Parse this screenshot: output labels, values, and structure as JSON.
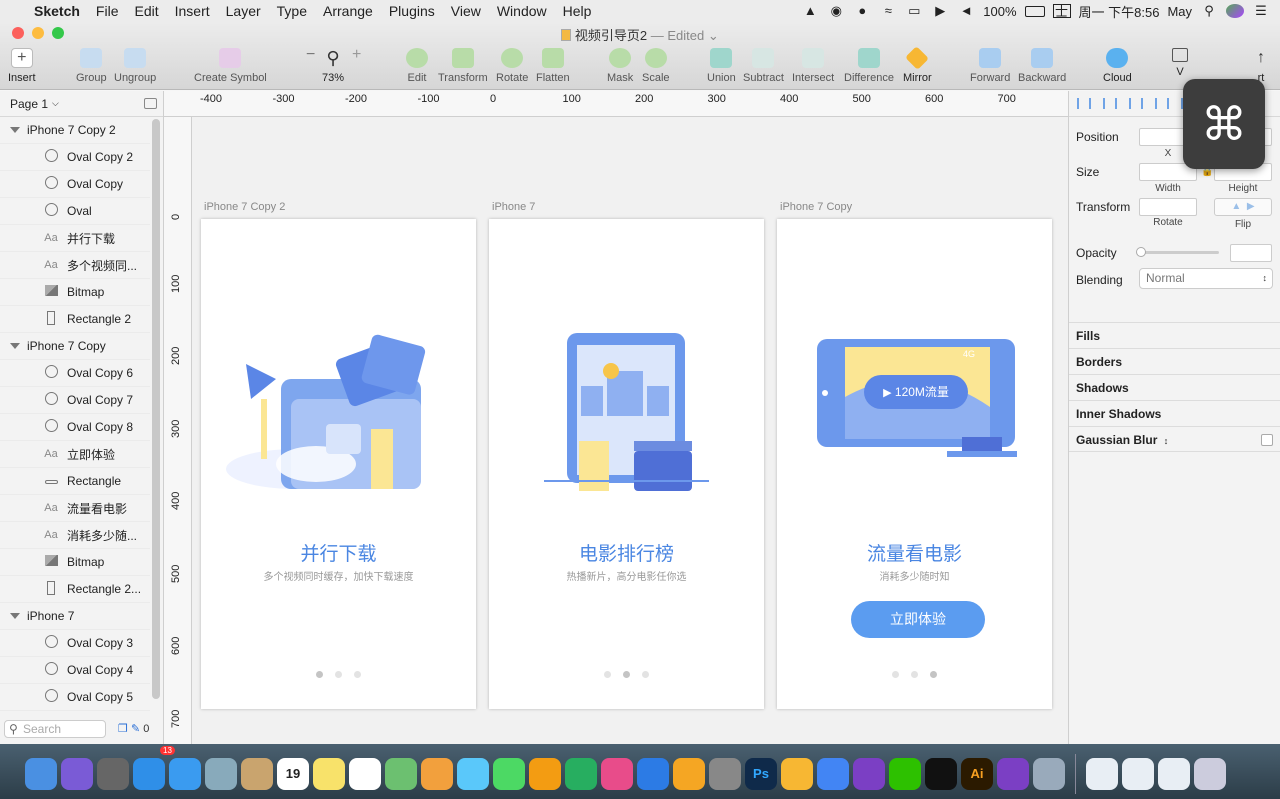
{
  "menubar": {
    "apple": "",
    "app": "Sketch",
    "items": [
      "File",
      "Edit",
      "Insert",
      "Layer",
      "Type",
      "Arrange",
      "Plugins",
      "View",
      "Window",
      "Help"
    ],
    "battery": "100%",
    "clock": "周一 下午8:56",
    "user": "May"
  },
  "window": {
    "title": "视频引导页2",
    "edited": " — Edited ⌄"
  },
  "toolbar": {
    "insert": "Insert",
    "group": "Group",
    "ungroup": "Ungroup",
    "create_symbol": "Create Symbol",
    "zoom_minus": "−",
    "zoom_plus": "+",
    "zoom": "73%",
    "edit": "Edit",
    "transform": "Transform",
    "rotate": "Rotate",
    "flatten": "Flatten",
    "mask": "Mask",
    "scale": "Scale",
    "union": "Union",
    "subtract": "Subtract",
    "intersect": "Intersect",
    "difference": "Difference",
    "mirror": "Mirror",
    "forward": "Forward",
    "backward": "Backward",
    "cloud": "Cloud",
    "view": "V",
    "export": "rt"
  },
  "layers": {
    "page": "Page 1",
    "rows": [
      {
        "kind": "group",
        "label": "iPhone 7 Copy 2"
      },
      {
        "kind": "oval",
        "label": "Oval Copy 2"
      },
      {
        "kind": "oval",
        "label": "Oval Copy"
      },
      {
        "kind": "oval",
        "label": "Oval"
      },
      {
        "kind": "text",
        "label": "并行下载"
      },
      {
        "kind": "text",
        "label": "多个视频同..."
      },
      {
        "kind": "bitmap",
        "label": "Bitmap"
      },
      {
        "kind": "rect",
        "label": "Rectangle 2"
      },
      {
        "kind": "group",
        "label": "iPhone 7 Copy"
      },
      {
        "kind": "oval",
        "label": "Oval Copy 6"
      },
      {
        "kind": "oval",
        "label": "Oval Copy 7"
      },
      {
        "kind": "oval",
        "label": "Oval Copy 8"
      },
      {
        "kind": "text",
        "label": "立即体验"
      },
      {
        "kind": "line",
        "label": "Rectangle"
      },
      {
        "kind": "text",
        "label": "流量看电影"
      },
      {
        "kind": "text",
        "label": "消耗多少随..."
      },
      {
        "kind": "bitmap",
        "label": "Bitmap"
      },
      {
        "kind": "rect",
        "label": "Rectangle 2..."
      },
      {
        "kind": "group",
        "label": "iPhone 7"
      },
      {
        "kind": "oval",
        "label": "Oval Copy 3"
      },
      {
        "kind": "oval",
        "label": "Oval Copy 4"
      },
      {
        "kind": "oval",
        "label": "Oval Copy 5"
      }
    ],
    "search_placeholder": "Search",
    "count": "0"
  },
  "rulers": {
    "h": [
      "-400",
      "-300",
      "-200",
      "-100",
      "0",
      "100",
      "200",
      "300",
      "400",
      "500",
      "600",
      "700"
    ],
    "v": [
      "0",
      "100",
      "200",
      "300",
      "400",
      "500",
      "600",
      "700"
    ]
  },
  "artboards": [
    {
      "label": "iPhone 7 Copy 2",
      "heading": "并行下载",
      "sub": "多个视频同时缓存，加快下载速度",
      "active_dot": 0,
      "cta": ""
    },
    {
      "label": "iPhone 7",
      "heading": "电影排行榜",
      "sub": "热播新片，高分电影任你选",
      "active_dot": 1,
      "cta": ""
    },
    {
      "label": "iPhone 7 Copy",
      "heading": "流量看电影",
      "sub": "消耗多少随时知",
      "active_dot": 2,
      "cta": "立即体验",
      "badge": "120M流量",
      "signal": "4G"
    }
  ],
  "inspector": {
    "position": "Position",
    "x": "X",
    "y": "Y",
    "size": "Size",
    "width": "Width",
    "height": "Height",
    "transform": "Transform",
    "rotate": "Rotate",
    "flip": "Flip",
    "opacity": "Opacity",
    "blending": "Blending",
    "blend_value": "Normal",
    "fills": "Fills",
    "borders": "Borders",
    "shadows": "Shadows",
    "inner_shadows": "Inner Shadows",
    "blur": "Gaussian Blur"
  },
  "overlay": {
    "symbol": "⌘"
  },
  "dock": {
    "apps": [
      "Finder",
      "Siri",
      "Launchpad",
      "App Store",
      "Safari",
      "Preview",
      "Contacts",
      "Calendar",
      "Notes",
      "Reminders",
      "Maps",
      "Photos",
      "Messages",
      "FaceTime",
      "Pages",
      "Numbers",
      "iTunes",
      "Keynote",
      "iBooks",
      "System Preferences",
      "Photoshop",
      "Sketch",
      "Chrome",
      "Pixso",
      "WeChat",
      "QQ",
      "Illustrator",
      "Pixso",
      "Image Capture"
    ],
    "calendar_day": "19",
    "appstore_badge": "13",
    "ps": "Ps",
    "ai": "Ai"
  },
  "colors": {
    "accent": "#4a86e2",
    "button": "#5b9cf0"
  }
}
